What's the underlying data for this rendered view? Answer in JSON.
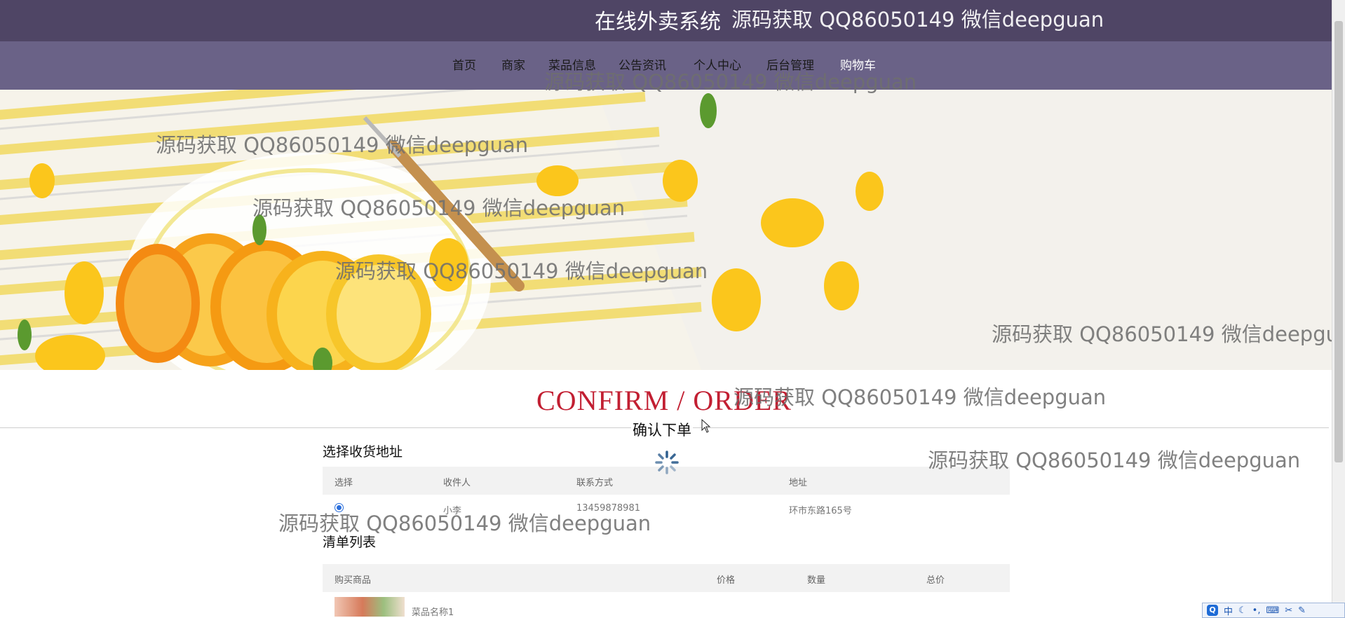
{
  "header": {
    "site_title": "在线外卖系统"
  },
  "nav": {
    "items": [
      "首页",
      "商家",
      "菜品信息",
      "公告资讯",
      "个人中心",
      "后台管理",
      "购物车"
    ]
  },
  "confirm": {
    "title_en": "CONFIRM / ORDER",
    "title_cn": "确认下单"
  },
  "address": {
    "section_title": "选择收货地址",
    "headers": [
      "选择",
      "收件人",
      "联系方式",
      "地址"
    ],
    "rows": [
      {
        "recipient": "小李",
        "phone": "13459878981",
        "address": "环市东路165号",
        "selected": true
      }
    ]
  },
  "cart": {
    "section_title": "清单列表",
    "headers": [
      "购买商品",
      "价格",
      "数量",
      "总价"
    ],
    "items": [
      {
        "name": "菜品名称1"
      }
    ]
  },
  "watermark_text": "源码获取 QQ86050149 微信deepguan",
  "tray": {
    "ime": "中"
  },
  "colors": {
    "header_bg": "#4f4565",
    "nav_bg": "#6a6287",
    "accent_red": "#c21f32"
  }
}
